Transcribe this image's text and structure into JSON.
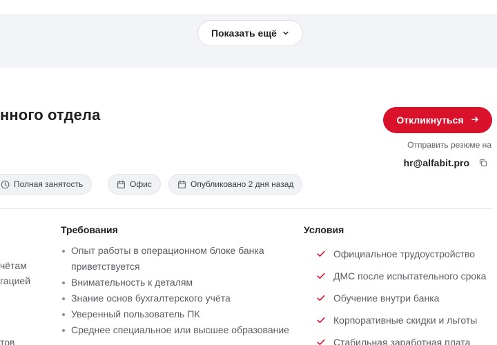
{
  "show_more": {
    "label": "Показать ещё"
  },
  "vacancy": {
    "title_visible": "нного отдела",
    "respond_label": "Откликнуться",
    "resume_note": "Отправить резюме на",
    "email": "hr@alfabit.pro"
  },
  "chips": [
    {
      "label": "Полная занятость",
      "icon": "clock-icon"
    },
    {
      "label": "Офис",
      "icon": "calendar-icon"
    },
    {
      "label": "Опубликовано 2 дня назад",
      "icon": "calendar-icon"
    }
  ],
  "left_fragments": [
    "чётам",
    "гацией",
    "тов"
  ],
  "requirements": {
    "heading": "Требования",
    "items": [
      "Опыт работы в операционном блоке банка приветствуется",
      "Внимательность к деталям",
      "Знание основ бухгалтерского учёта",
      "Уверенный пользователь ПК",
      "Среднее специальное или высшее образование"
    ]
  },
  "conditions": {
    "heading": "Условия",
    "items": [
      "Официальное трудоустройство",
      "ДМС после испытательного срока",
      "Обучение внутри банка",
      "Корпоративные скидки и льготы",
      "Стабильная заработная плата"
    ]
  },
  "colors": {
    "accent": "#d9112a",
    "band": "#f3f4f7",
    "chip": "#f1f2f5"
  }
}
